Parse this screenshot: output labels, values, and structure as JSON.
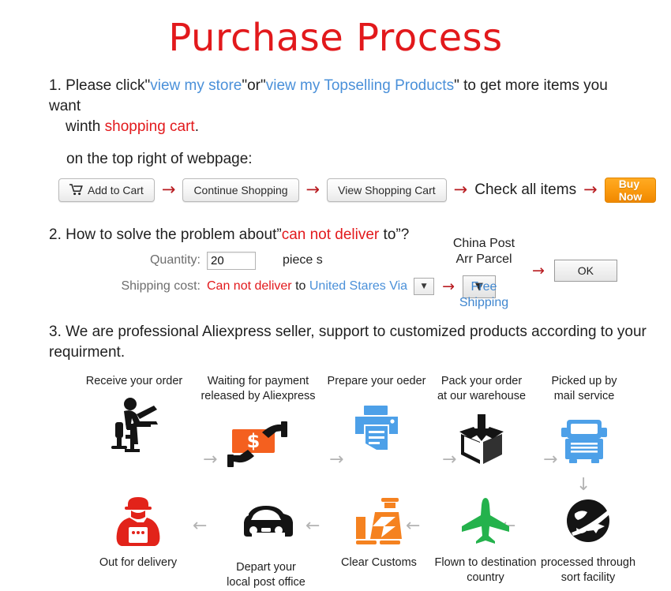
{
  "page": {
    "title": "Purchase Process",
    "title_color": "#e2191c",
    "link_color": "#4a90d9",
    "accent_red": "#e2191c",
    "arrow_red": "#b81b20",
    "buy_orange": "#f59000"
  },
  "step1": {
    "number": "1.",
    "t1": "Please click",
    "q1": "\"",
    "link1": "view my store",
    "q2": "\"",
    "or": "or",
    "q3": "\"",
    "link2": "view my Topselling Products",
    "q4": "\"",
    "t2": " to get more items you want",
    "t3": "winth ",
    "highlight": "shopping cart",
    "t4": ".",
    "subline": "on the top right of webpage:",
    "buttons": {
      "add_to_cart": "Add to Cart",
      "continue_shopping": "Continue Shopping",
      "view_shopping_cart": "View Shopping Cart",
      "check_all_items": "Check all items",
      "buy_now": "Buy Now"
    },
    "arrow": "→"
  },
  "step2": {
    "number": "2.",
    "heading_a": "How to solve the problem about",
    "heading_q1": "”",
    "heading_red": "can not deliver",
    "heading_b": " to",
    "heading_q2": "”?",
    "quantity_label": "Quantity:",
    "quantity_value": "20",
    "piece_label": "piece s",
    "shipping_label": "Shipping cost:",
    "shipping_red": "Can not deliver",
    "shipping_to": " to ",
    "shipping_blue": "United Stares Via",
    "dropdown_caret": "▼",
    "arrow": "→",
    "post_line1": "China Post",
    "post_line2": "Arr Parcel",
    "post_free1": "Free",
    "post_free2": "Shipping",
    "ok_label": "OK"
  },
  "step3": {
    "number": "3.",
    "text": "We are professional Aliexpress seller, support to customized products according to your requirment.",
    "row1": [
      {
        "label_line1": "Receive your order",
        "label_line2": "",
        "icon": "person-at-desk-icon"
      },
      {
        "label_line1": "Waiting for payment",
        "label_line2": "released by Aliexpress",
        "icon": "hand-money-icon"
      },
      {
        "label_line1": "Prepare your oeder",
        "label_line2": "",
        "icon": "printer-icon"
      },
      {
        "label_line1": "Pack your order",
        "label_line2": "at our warehouse",
        "icon": "box-packing-icon"
      },
      {
        "label_line1": "Picked up by",
        "label_line2": "mail service",
        "icon": "truck-icon"
      }
    ],
    "row2": [
      {
        "label_line1": "Out for delivery",
        "label_line2": "",
        "icon": "delivery-person-icon"
      },
      {
        "label_line1": "Depart your",
        "label_line2": "local post office",
        "icon": "car-icon"
      },
      {
        "label_line1": "Clear Customs",
        "label_line2": "",
        "icon": "customs-officer-icon"
      },
      {
        "label_line1": "Flown to destination",
        "label_line2": "country",
        "icon": "airplane-icon"
      },
      {
        "label_line1": "processed through",
        "label_line2": "sort facility",
        "icon": "globe-plane-icon"
      }
    ],
    "arrow_right": "→",
    "arrow_left": "←",
    "arrow_down": "↓",
    "icon_colors": {
      "black": "#141414",
      "blue": "#4da0e8",
      "orange": "#f4601f",
      "orange2": "#f58220",
      "red": "#e2231a",
      "green": "#24b24c",
      "arrow_gray": "#b3b3b3"
    }
  }
}
